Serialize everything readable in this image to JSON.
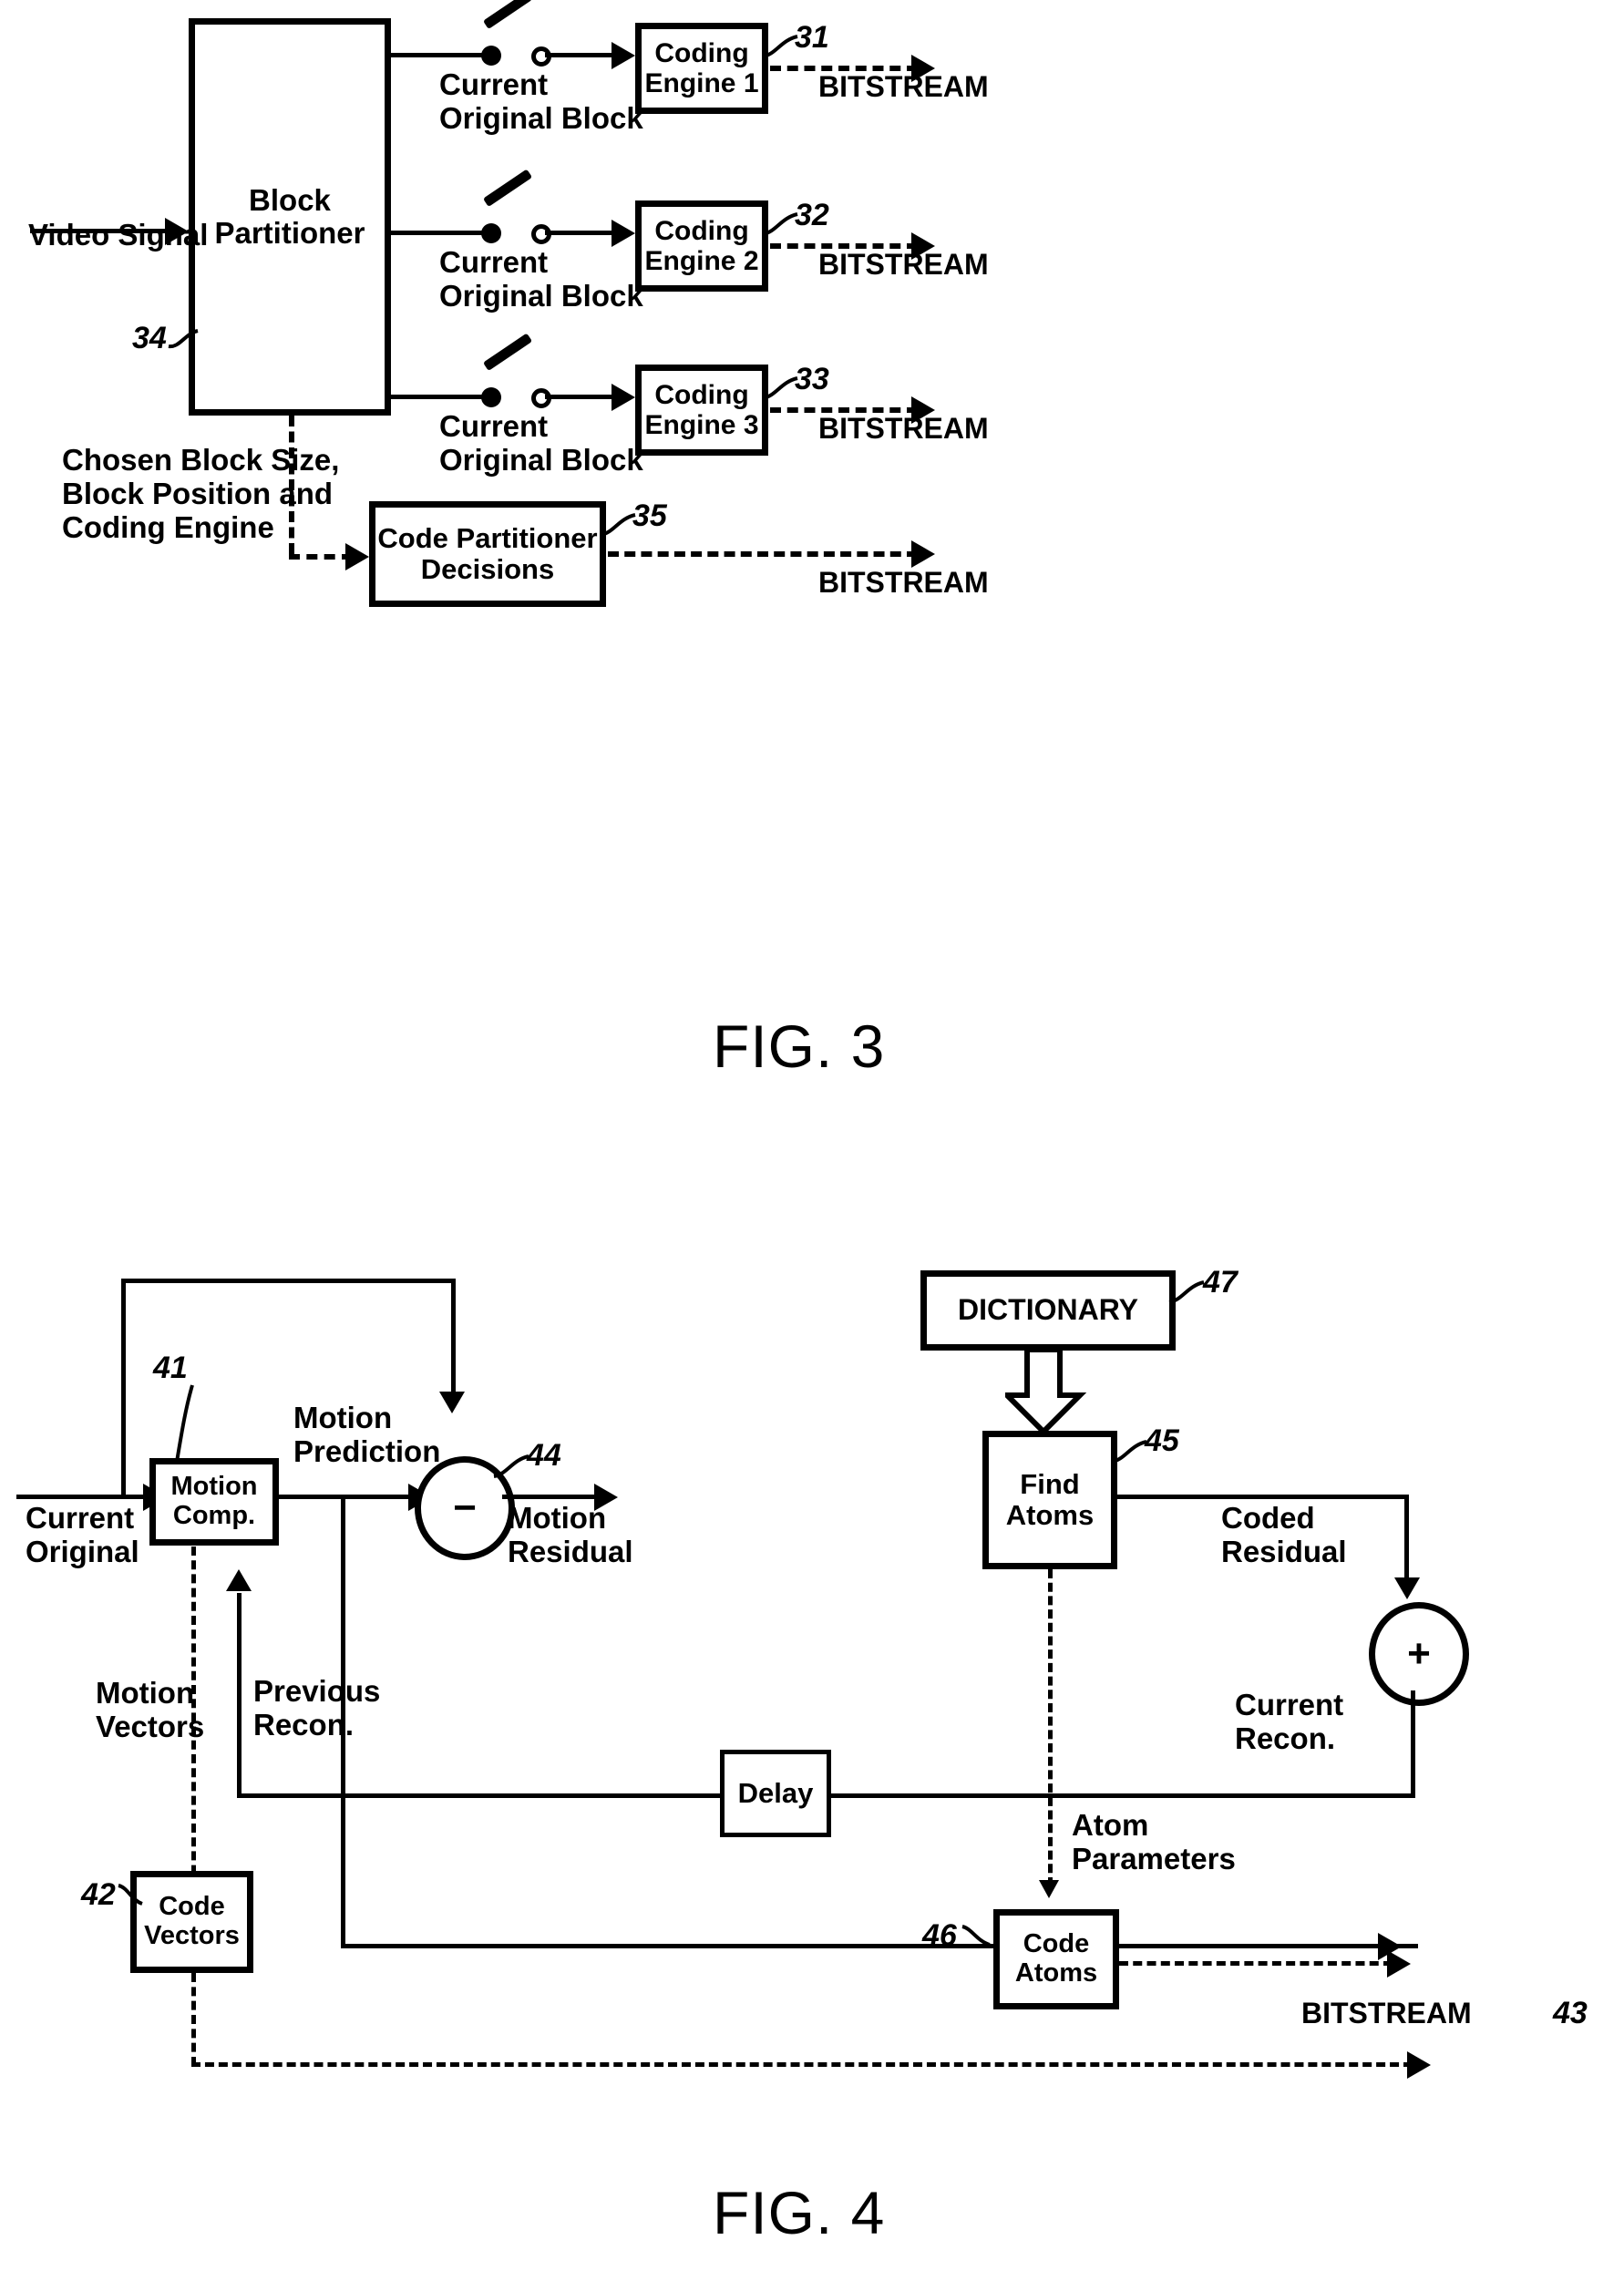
{
  "figures": [
    {
      "caption": "FIG. 3",
      "blocks": [
        {
          "id": "34",
          "label_line1": "Block",
          "label_line2": "Partitioner"
        },
        {
          "id": "31",
          "label_line1": "Coding",
          "label_line2": "Engine 1"
        },
        {
          "id": "32",
          "label_line1": "Coding",
          "label_line2": "Engine 2"
        },
        {
          "id": "33",
          "label_line1": "Coding",
          "label_line2": "Engine 3"
        },
        {
          "id": "35",
          "label_line1": "Code Partitioner",
          "label_line2": "Decisions"
        }
      ],
      "signals": {
        "input": "Video Signal",
        "switch_label_l1": "Current",
        "switch_label_l2": "Original Block",
        "bitstream": "BITSTREAM",
        "decisions_l1": "Chosen Block Size,",
        "decisions_l2": "Block Position and",
        "decisions_l3": "Coding Engine"
      }
    },
    {
      "caption": "FIG. 4",
      "blocks": [
        {
          "id": "41",
          "label_line1": "Motion",
          "label_line2": "Comp."
        },
        {
          "id": "47",
          "label_line1": "DICTIONARY",
          "label_line2": ""
        },
        {
          "id": "45",
          "label_line1": "Find",
          "label_line2": "Atoms"
        },
        {
          "id": "42",
          "label_line1": "Code",
          "label_line2": "Vectors"
        },
        {
          "id": "46",
          "label_line1": "Code",
          "label_line2": "Atoms"
        },
        {
          "id": "",
          "label_line1": "Delay",
          "label_line2": ""
        }
      ],
      "nodes": [
        {
          "id": "44",
          "op": "−"
        },
        {
          "id": "",
          "op": "+"
        }
      ],
      "signals": {
        "input_l1": "Current",
        "input_l2": "Original",
        "motion_prediction_l1": "Motion",
        "motion_prediction_l2": "Prediction",
        "motion_residual_l1": "Motion",
        "motion_residual_l2": "Residual",
        "coded_residual_l1": "Coded",
        "coded_residual_l2": "Residual",
        "current_recon_l1": "Current",
        "current_recon_l2": "Recon.",
        "previous_recon_l1": "Previous",
        "previous_recon_l2": "Recon.",
        "motion_vectors_l1": "Motion",
        "motion_vectors_l2": "Vectors",
        "atom_parameters_l1": "Atom",
        "atom_parameters_l2": "Parameters",
        "bitstream": "BITSTREAM",
        "bitstream_ref": "43"
      }
    }
  ],
  "colors": {
    "ink": "#000000",
    "paper": "#ffffff"
  }
}
